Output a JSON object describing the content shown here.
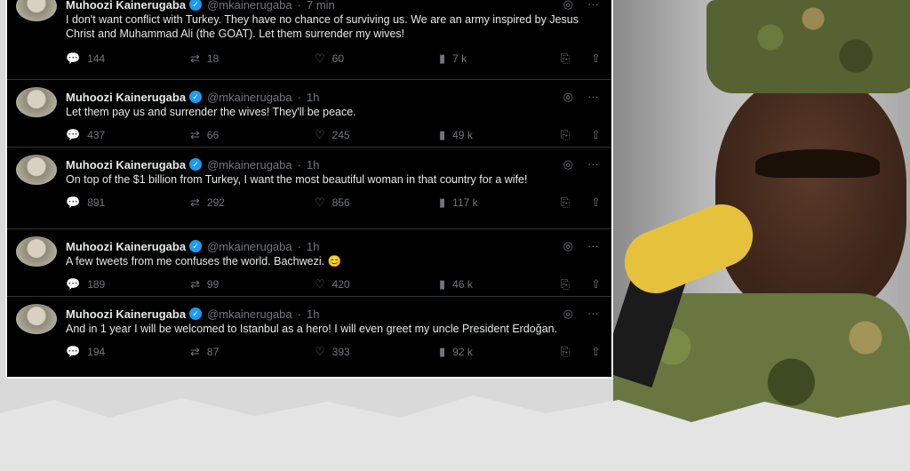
{
  "tweets": [
    {
      "name": "Muhoozi Kainerugaba",
      "handle": "@mkainerugaba",
      "time": "7 min",
      "text": "I don't want conflict with Turkey. They have no chance of surviving us. We are an army inspired by Jesus Christ and Muhammad Ali (the GOAT). Let them surrender my wives!",
      "replies": "144",
      "reposts": "18",
      "likes": "60",
      "views": "7 k"
    },
    {
      "name": "Muhoozi Kainerugaba",
      "handle": "@mkainerugaba",
      "time": "1h",
      "text": "Let them pay us and surrender the wives! They'll be peace.",
      "replies": "437",
      "reposts": "66",
      "likes": "245",
      "views": "49 k"
    },
    {
      "name": "Muhoozi Kainerugaba",
      "handle": "@mkainerugaba",
      "time": "1h",
      "text": "On top of the $1 billion from Turkey, I want the most beautiful woman in that country for a wife!",
      "replies": "891",
      "reposts": "292",
      "likes": "856",
      "views": "117 k"
    },
    {
      "name": "Muhoozi Kainerugaba",
      "handle": "@mkainerugaba",
      "time": "1h",
      "text": "A few tweets from me confuses the world. Bachwezi. 😊",
      "replies": "189",
      "reposts": "99",
      "likes": "420",
      "views": "46 k"
    },
    {
      "name": "Muhoozi Kainerugaba",
      "handle": "@mkainerugaba",
      "time": "1h",
      "text": "And in 1 year I will be welcomed to Istanbul as a hero! I will even greet my uncle President Erdoğan.",
      "replies": "194",
      "reposts": "87",
      "likes": "393",
      "views": "92 k"
    }
  ],
  "icons": {
    "verified": "✓",
    "grok": "◎",
    "more": "···",
    "reply": "💬",
    "repost": "⇄",
    "like": "♡",
    "views": "▮",
    "bookmark": "⎘",
    "share": "⇧"
  }
}
